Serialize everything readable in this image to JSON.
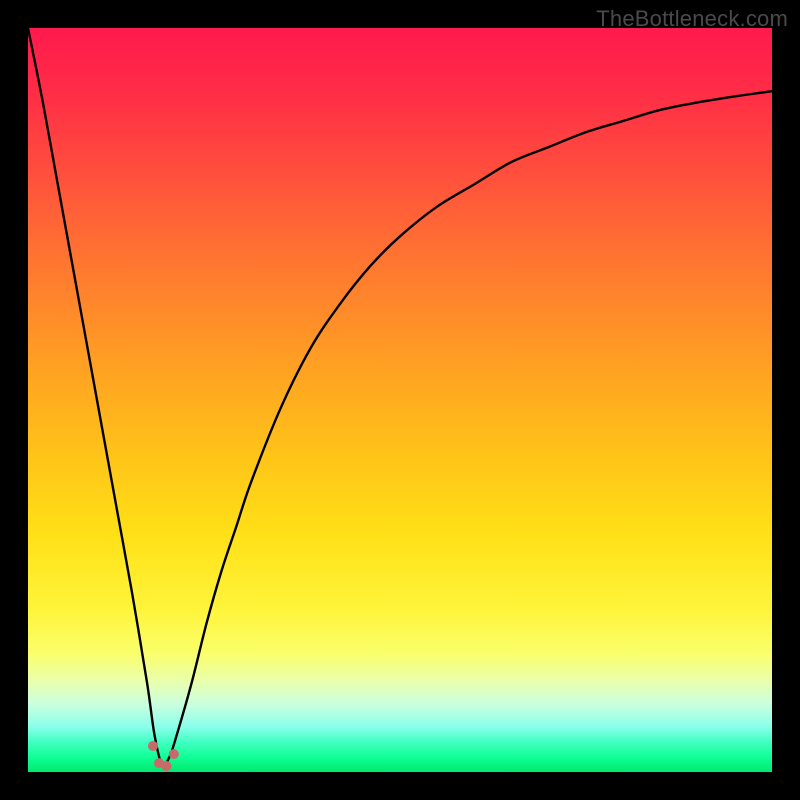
{
  "watermark": "TheBottleneck.com",
  "colors": {
    "frame": "#000000",
    "curve_stroke": "#000000",
    "marker_stroke": "#c96a6a",
    "gradient_top": "#ff1a4d",
    "gradient_bottom": "#00e86e"
  },
  "chart_data": {
    "type": "line",
    "title": "",
    "xlabel": "",
    "ylabel": "",
    "xlim": [
      0,
      100
    ],
    "ylim": [
      0,
      100
    ],
    "grid": false,
    "legend": false,
    "notes": "V-shaped bottleneck curve. ylim top = worst (red), bottom = best (green). Minimum of the curve sits near x≈18, y≈0.",
    "series": [
      {
        "name": "bottleneck-curve",
        "x": [
          0,
          2,
          4,
          6,
          8,
          10,
          12,
          14,
          16,
          17,
          18,
          19,
          20,
          22,
          24,
          26,
          28,
          30,
          34,
          38,
          42,
          46,
          50,
          55,
          60,
          65,
          70,
          75,
          80,
          85,
          90,
          95,
          100
        ],
        "y": [
          100,
          90,
          79,
          68,
          57,
          46,
          35,
          24,
          12,
          5,
          1,
          2,
          5,
          12,
          20,
          27,
          33,
          39,
          49,
          57,
          63,
          68,
          72,
          76,
          79,
          82,
          84,
          86,
          87.5,
          89,
          90,
          90.8,
          91.5
        ]
      }
    ],
    "markers": {
      "name": "optimum-cluster",
      "points": [
        {
          "x": 16.8,
          "y": 3.5
        },
        {
          "x": 17.6,
          "y": 1.2
        },
        {
          "x": 18.6,
          "y": 0.8
        },
        {
          "x": 19.6,
          "y": 2.4
        }
      ]
    }
  }
}
